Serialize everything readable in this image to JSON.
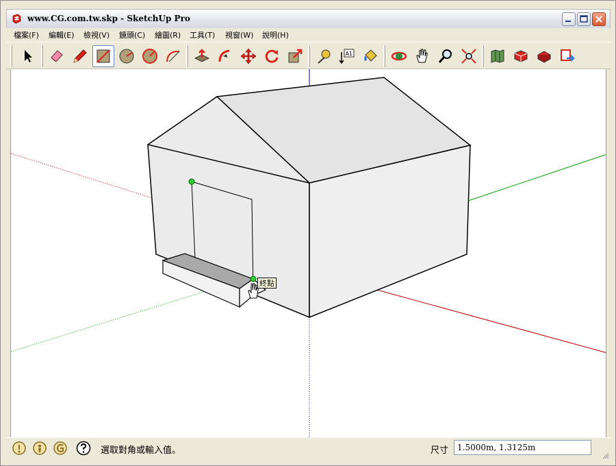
{
  "window": {
    "title": "www.CG.com.tw.skp - SketchUp Pro"
  },
  "menu": {
    "items": [
      {
        "label": "檔案(F)"
      },
      {
        "label": "編輯(E)"
      },
      {
        "label": "檢視(V)"
      },
      {
        "label": "鏡頭(C)"
      },
      {
        "label": "繪圖(R)"
      },
      {
        "label": "工具(T)"
      },
      {
        "label": "視窗(W)"
      },
      {
        "label": "說明(H)"
      }
    ]
  },
  "toolbar": {
    "tools": [
      {
        "icon": "select-arrow-icon"
      },
      {
        "icon": "eraser-icon"
      },
      {
        "icon": "pencil-line-icon"
      },
      {
        "icon": "rectangle-icon",
        "active": true
      },
      {
        "icon": "circle-icon"
      },
      {
        "icon": "polygon-icon"
      },
      {
        "icon": "arc-icon"
      },
      {
        "icon": "push-pull-icon"
      },
      {
        "icon": "follow-me-icon"
      },
      {
        "icon": "move-icon"
      },
      {
        "icon": "rotate-icon"
      },
      {
        "icon": "scale-icon"
      },
      {
        "icon": "tape-measure-icon"
      },
      {
        "icon": "text-label-icon"
      },
      {
        "icon": "paint-bucket-icon"
      },
      {
        "icon": "orbit-icon"
      },
      {
        "icon": "pan-hand-icon"
      },
      {
        "icon": "zoom-icon"
      },
      {
        "icon": "zoom-extents-icon"
      },
      {
        "icon": "get-models-icon"
      },
      {
        "icon": "share-model-icon"
      },
      {
        "icon": "extension-warehouse-icon"
      },
      {
        "icon": "send-to-layout-icon"
      }
    ],
    "text_tool_label": "A1"
  },
  "viewport": {
    "tooltip": "終點",
    "axis_colors": {
      "red": "#c00000",
      "green": "#00a000",
      "blue": "#0000c0"
    }
  },
  "status": {
    "message": "選取對角或輸入值。",
    "measurements_label": "尺寸",
    "measurements_value": "1.5000m, 1.3125m"
  }
}
